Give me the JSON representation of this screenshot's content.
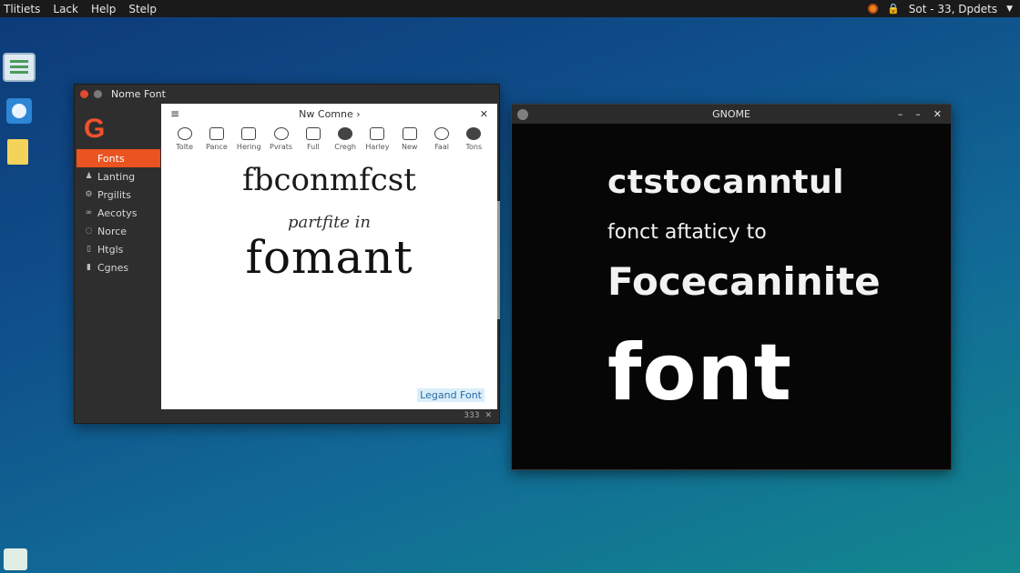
{
  "top_panel": {
    "menus": [
      "Tlitiets",
      "Lack",
      "Help",
      "Stelp"
    ],
    "status_text": "Sot - 33, Dpdets"
  },
  "window1": {
    "title": "Nome Font",
    "logo": "G",
    "sidebar": [
      {
        "label": "Fonts",
        "icon": "font-icon",
        "active": true
      },
      {
        "label": "Lanting",
        "icon": "person-icon"
      },
      {
        "label": "Prgilits",
        "icon": "gear-icon"
      },
      {
        "label": "Aecotys",
        "icon": "link-icon"
      },
      {
        "label": "Norce",
        "icon": "bulb-icon"
      },
      {
        "label": "Htgls",
        "icon": "door-icon"
      },
      {
        "label": "Cgnes",
        "icon": "folder-icon"
      }
    ],
    "doc_title": "Nw Comne",
    "toolbar": [
      "Tolte",
      "Pance",
      "Hering",
      "Pvrats",
      "Full",
      "Cregh",
      "Harley",
      "New",
      "Faal",
      "Tons"
    ],
    "text_lines": [
      "fbconmfcst",
      "partfite in",
      "fomant"
    ],
    "legend": "Legand Font",
    "status": "333"
  },
  "window2": {
    "title": "GNOME",
    "text_lines": [
      "ctstocanntul",
      "fonct aftaticy to",
      "Focecaninite",
      "font"
    ]
  }
}
